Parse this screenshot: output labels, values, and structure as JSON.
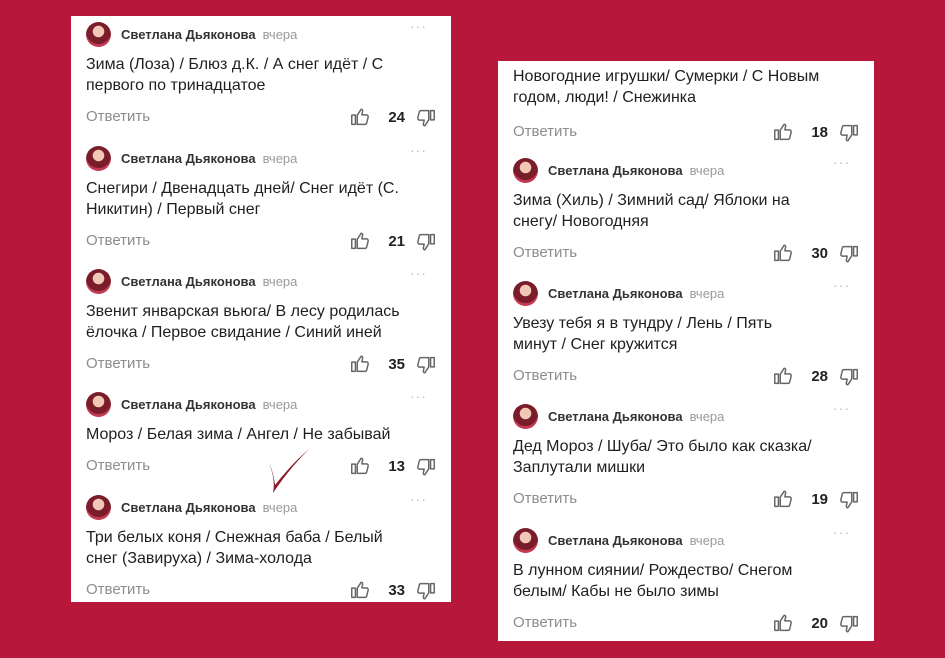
{
  "left_column": [
    {
      "author": "Светлана Дьяконова",
      "when": "вчера",
      "more": "···",
      "text_lines": [
        "Зима (Лоза)  / Блюз д.К. / А снег идёт / С",
        "первого по тринадцатое"
      ],
      "reply": "Ответить",
      "likes": "24"
    },
    {
      "author": "Светлана Дьяконова",
      "when": "вчера",
      "more": "···",
      "text_lines": [
        "Снегири / Двенадцать дней/ Снег идёт (С.",
        "Никитин) / Первый снег"
      ],
      "reply": "Ответить",
      "likes": "21"
    },
    {
      "author": "Светлана Дьяконова",
      "when": "вчера",
      "more": "···",
      "text_lines": [
        "Звенит январская вьюга/ В лесу родилась",
        "ёлочка / Первое свидание / Синий иней"
      ],
      "reply": "Ответить",
      "likes": "35"
    },
    {
      "author": "Светлана Дьяконова",
      "when": "вчера",
      "more": "···",
      "text_lines": [
        "Мороз / Белая зима / Ангел /  Не забывай"
      ],
      "reply": "Ответить",
      "likes": "13"
    },
    {
      "author": "Светлана Дьяконова",
      "when": "вчера",
      "more": "···",
      "text_lines": [
        "Три белых коня / Снежная баба / Белый",
        "снег (Завируха) / Зима-холода"
      ],
      "reply": "Ответить",
      "likes": "33"
    }
  ],
  "right_column": [
    {
      "author": "",
      "when": "",
      "more": "",
      "text_lines": [
        "Новогодние игрушки/ Сумерки / С Новым",
        "годом, люди! / Снежинка"
      ],
      "reply": "Ответить",
      "likes": "18"
    },
    {
      "author": "Светлана Дьяконова",
      "when": "вчера",
      "more": "···",
      "text_lines": [
        "Зима (Хиль) / Зимний сад/ Яблоки на",
        "снегу/ Новогодняя"
      ],
      "reply": "Ответить",
      "likes": "30"
    },
    {
      "author": "Светлана Дьяконова",
      "when": "вчера",
      "more": "···",
      "text_lines": [
        "Увезу тебя я в тундру / Лень / Пять",
        "минут / Снег кружится"
      ],
      "reply": "Ответить",
      "likes": "28"
    },
    {
      "author": "Светлана Дьяконова",
      "when": "вчера",
      "more": "···",
      "text_lines": [
        "Дед Мороз / Шуба/ Это было как сказка/",
        "Заплутали мишки"
      ],
      "reply": "Ответить",
      "likes": "19"
    },
    {
      "author": "Светлана Дьяконова",
      "when": "вчера",
      "more": "···",
      "text_lines": [
        "В лунном сиянии/ Рождество/ Снегом",
        "белым/ Кабы не было зимы"
      ],
      "reply": "Ответить",
      "likes": "20"
    }
  ],
  "colors": {
    "background": "#b8173c",
    "checkmark": "#8b1a2c"
  },
  "icons": {
    "like": "thumbs-up-icon",
    "dislike": "thumbs-down-icon",
    "more": "ellipsis-icon",
    "mark": "handwritten-checkmark"
  }
}
